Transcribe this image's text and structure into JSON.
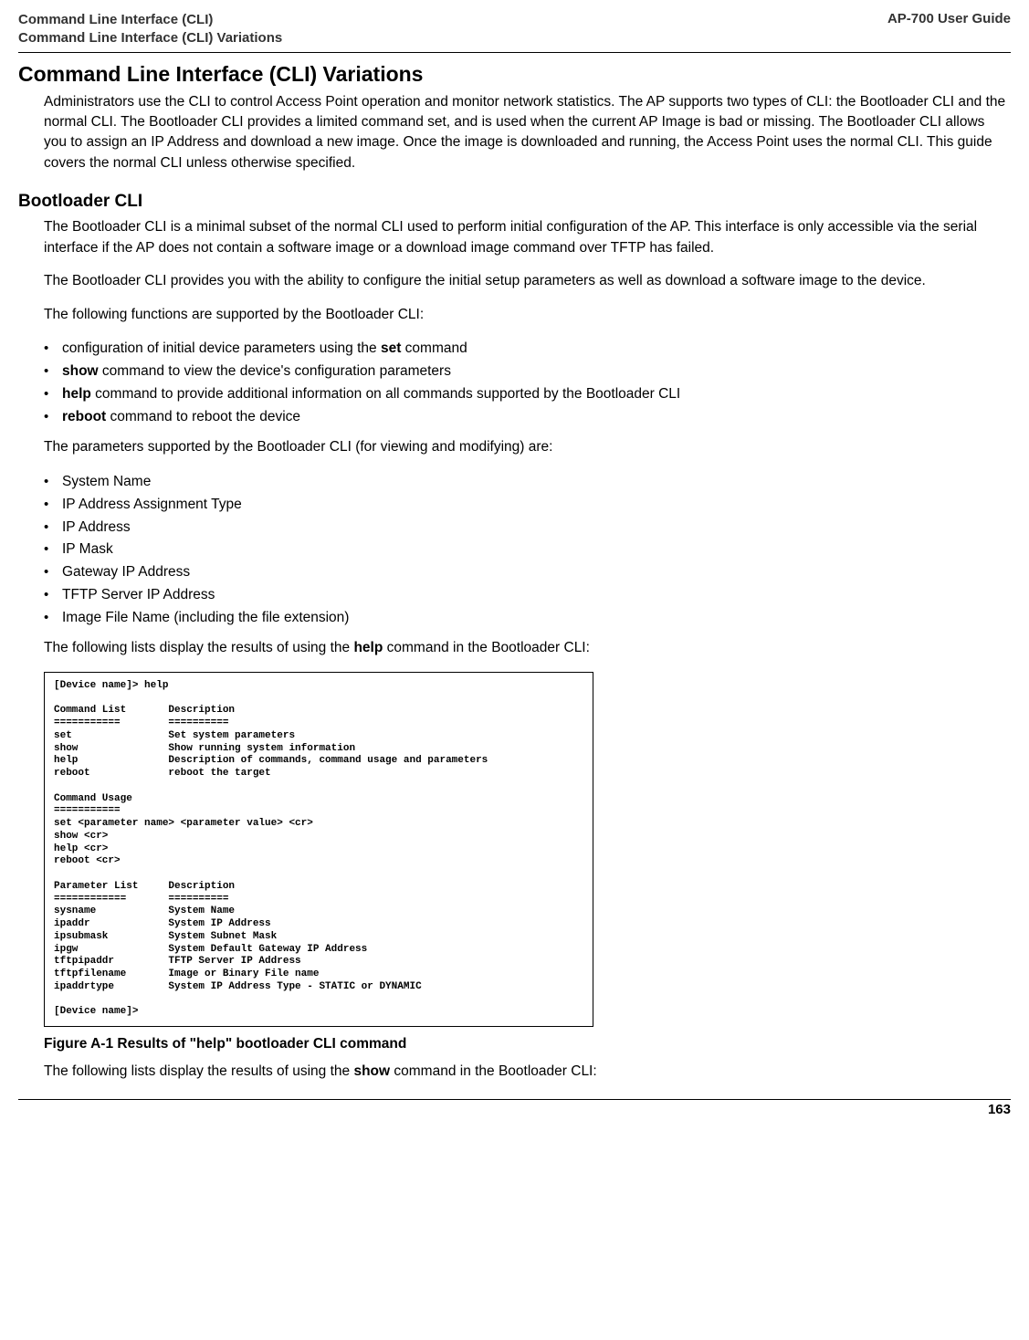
{
  "header": {
    "left_line1": "Command Line Interface (CLI)",
    "left_line2": "Command Line Interface (CLI) Variations",
    "right": "AP-700 User Guide"
  },
  "section": {
    "heading": "Command Line Interface (CLI) Variations",
    "intro": "Administrators use the CLI to control Access Point operation and monitor network statistics. The AP supports two types of CLI: the Bootloader CLI and the normal CLI. The Bootloader CLI provides a limited command set, and is used when the current AP Image is bad or missing. The Bootloader CLI allows you to assign an IP Address and download a new image. Once the image is downloaded and running, the Access Point uses the normal CLI. This guide covers the normal CLI unless otherwise specified."
  },
  "bootloader": {
    "heading": "Bootloader CLI",
    "p1": "The Bootloader CLI is a minimal subset of the normal CLI used to perform initial configuration of the AP. This interface is only accessible via the serial interface if the AP does not contain a software image or a download image command over TFTP has failed.",
    "p2": "The Bootloader CLI provides you with the ability to configure the initial setup parameters as well as download a software image to the device.",
    "p3": "The following functions are supported by the Bootloader CLI:",
    "func_list": [
      {
        "pre": "configuration of initial device parameters using the ",
        "bold": "set",
        "post": " command"
      },
      {
        "pre": "",
        "bold": "show",
        "post": " command to view the device's configuration parameters"
      },
      {
        "pre": "",
        "bold": "help",
        "post": " command to provide additional information on all commands supported by the Bootloader CLI"
      },
      {
        "pre": "",
        "bold": "reboot",
        "post": " command to reboot the device"
      }
    ],
    "p4": "The parameters supported by the Bootloader CLI (for viewing and modifying) are:",
    "param_list": [
      "System Name",
      "IP Address Assignment Type",
      "IP Address",
      "IP Mask",
      "Gateway IP Address",
      "TFTP Server IP Address",
      "Image File Name (including the file extension)"
    ],
    "p5_pre": "The following lists display the results of using the ",
    "p5_bold": "help",
    "p5_post": " command in the Bootloader CLI:",
    "cli_output": "[Device name]> help\n\nCommand List       Description\n===========        ==========\nset                Set system parameters\nshow               Show running system information\nhelp               Description of commands, command usage and parameters\nreboot             reboot the target\n\nCommand Usage\n===========\nset <parameter name> <parameter value> <cr>\nshow <cr>\nhelp <cr>\nreboot <cr>\n\nParameter List     Description\n============       ==========\nsysname            System Name\nipaddr             System IP Address\nipsubmask          System Subnet Mask\nipgw               System Default Gateway IP Address\ntftpipaddr         TFTP Server IP Address\ntftpfilename       Image or Binary File name\nipaddrtype         System IP Address Type - STATIC or DYNAMIC\n\n[Device name]>",
    "figure_caption": "Figure A-1 Results of \"help\" bootloader CLI command",
    "p6_pre": "The following lists display the results of using the ",
    "p6_bold": "show",
    "p6_post": " command in the Bootloader CLI:"
  },
  "footer": {
    "page_number": "163"
  }
}
